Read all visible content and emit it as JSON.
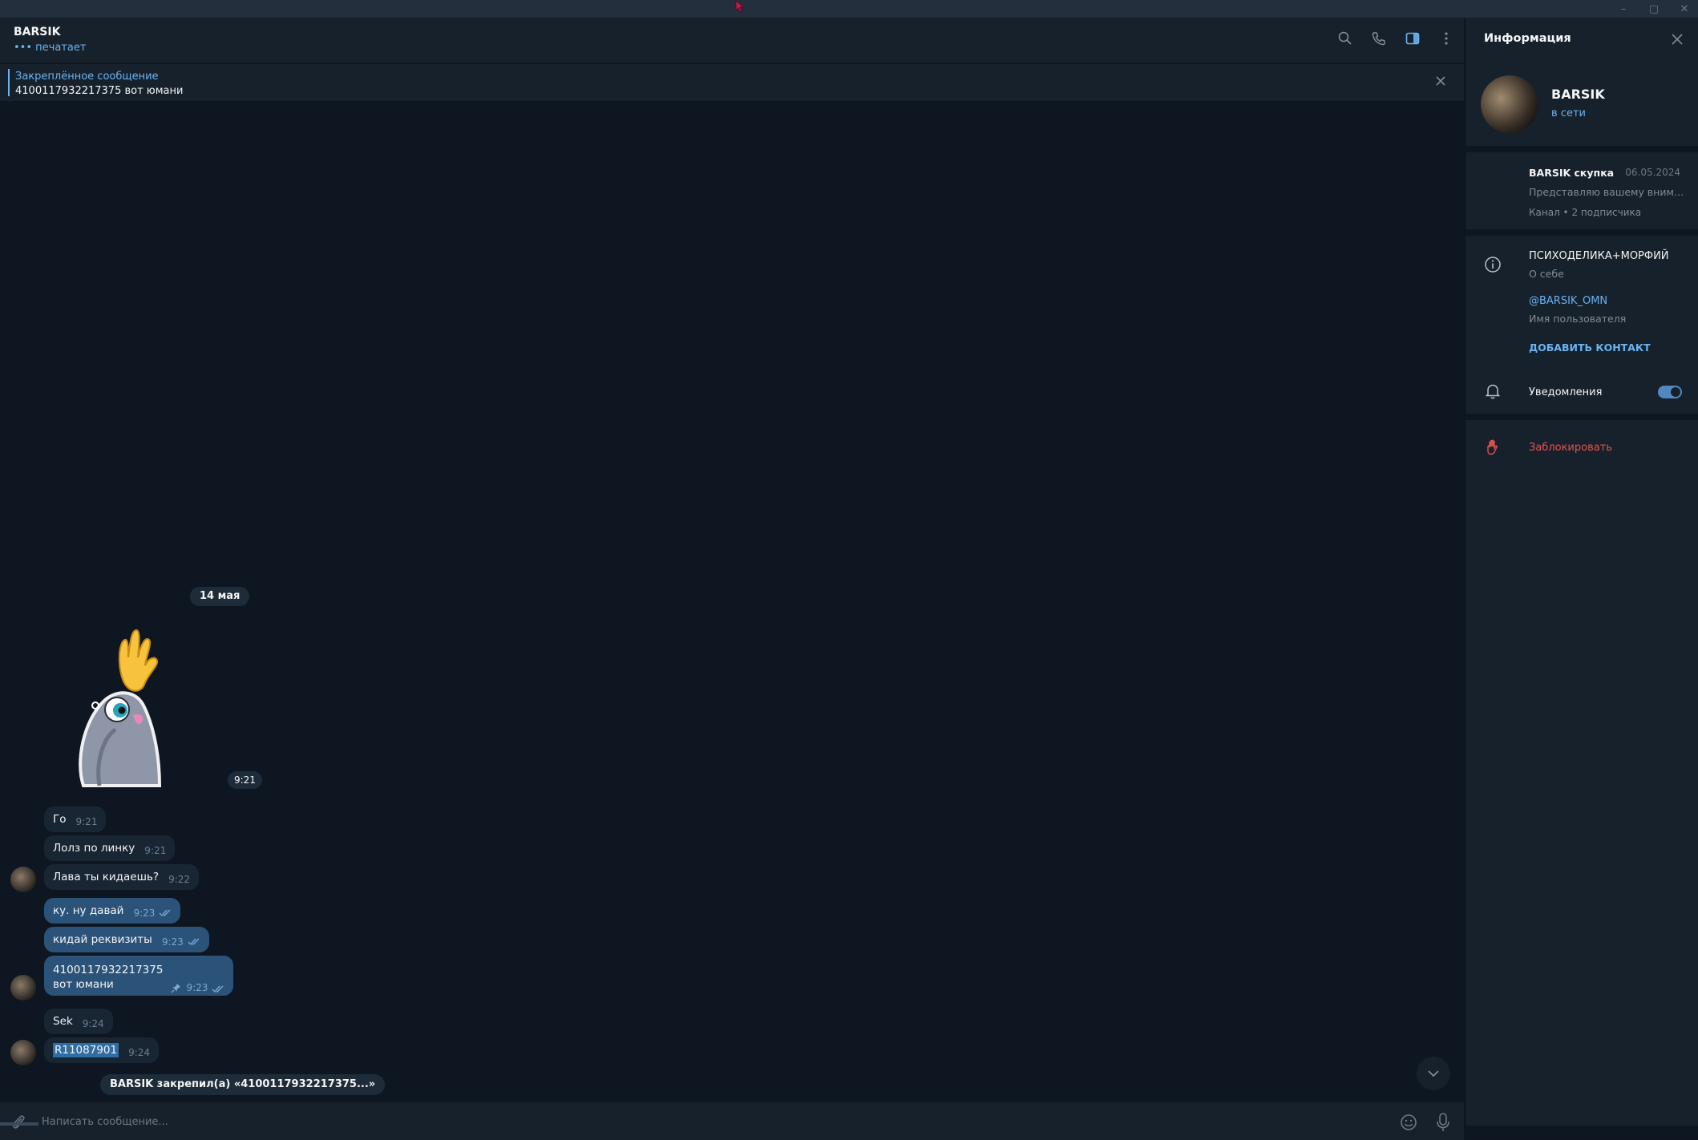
{
  "window": {
    "controls": [
      "–",
      "▢",
      "✕"
    ]
  },
  "chat_header": {
    "name": "BARSIK",
    "status": "••• печатает"
  },
  "pinned": {
    "title": "Закреплённое сообщение",
    "text": "4100117932217375 вот юмани"
  },
  "date_separator": "14 мая",
  "sticker": {
    "time": "9:21"
  },
  "messages": [
    {
      "text": "Го",
      "time": "9:21"
    },
    {
      "text": "Лолз по линку",
      "time": "9:21"
    },
    {
      "text": "Лава ты кидаешь?",
      "time": "9:22"
    },
    {
      "text": "ку. ну давай",
      "time": "9:23"
    },
    {
      "text": "кидай реквизиты",
      "time": "9:23"
    },
    {
      "line1": "4100117932217375",
      "line2": "вот юмани",
      "time": "9:23"
    },
    {
      "text": "Sek",
      "time": "9:24"
    },
    {
      "text": "R11087901",
      "time": "9:24"
    }
  ],
  "service_message": "BARSIK закрепил(а) «4100117932217375...»",
  "composer": {
    "placeholder": "Написать сообщение..."
  },
  "info": {
    "title": "Информация",
    "name": "BARSIK",
    "status": "в сети",
    "channel": {
      "name": "BARSIK скупка",
      "date": "06.05.2024",
      "preview": "Представляю вашему внима...",
      "subtitle": "Канал • 2 подписчика"
    },
    "bio": {
      "value": "ПСИХОДЕЛИКА+МОРФИЙ",
      "label": "О себе"
    },
    "username": {
      "value": "@BARSIK_OMN",
      "label": "Имя пользователя"
    },
    "add_contact": "ДОБАВИТЬ КОНТАКТ",
    "notifications": {
      "label": "Уведомления",
      "enabled": true
    },
    "block": "Заблокировать"
  },
  "colors": {
    "accent": "#6ab3f3",
    "danger": "#e5524f",
    "bg": "#0e1621",
    "panel": "#17212b",
    "outgoing": "#2b5278"
  }
}
